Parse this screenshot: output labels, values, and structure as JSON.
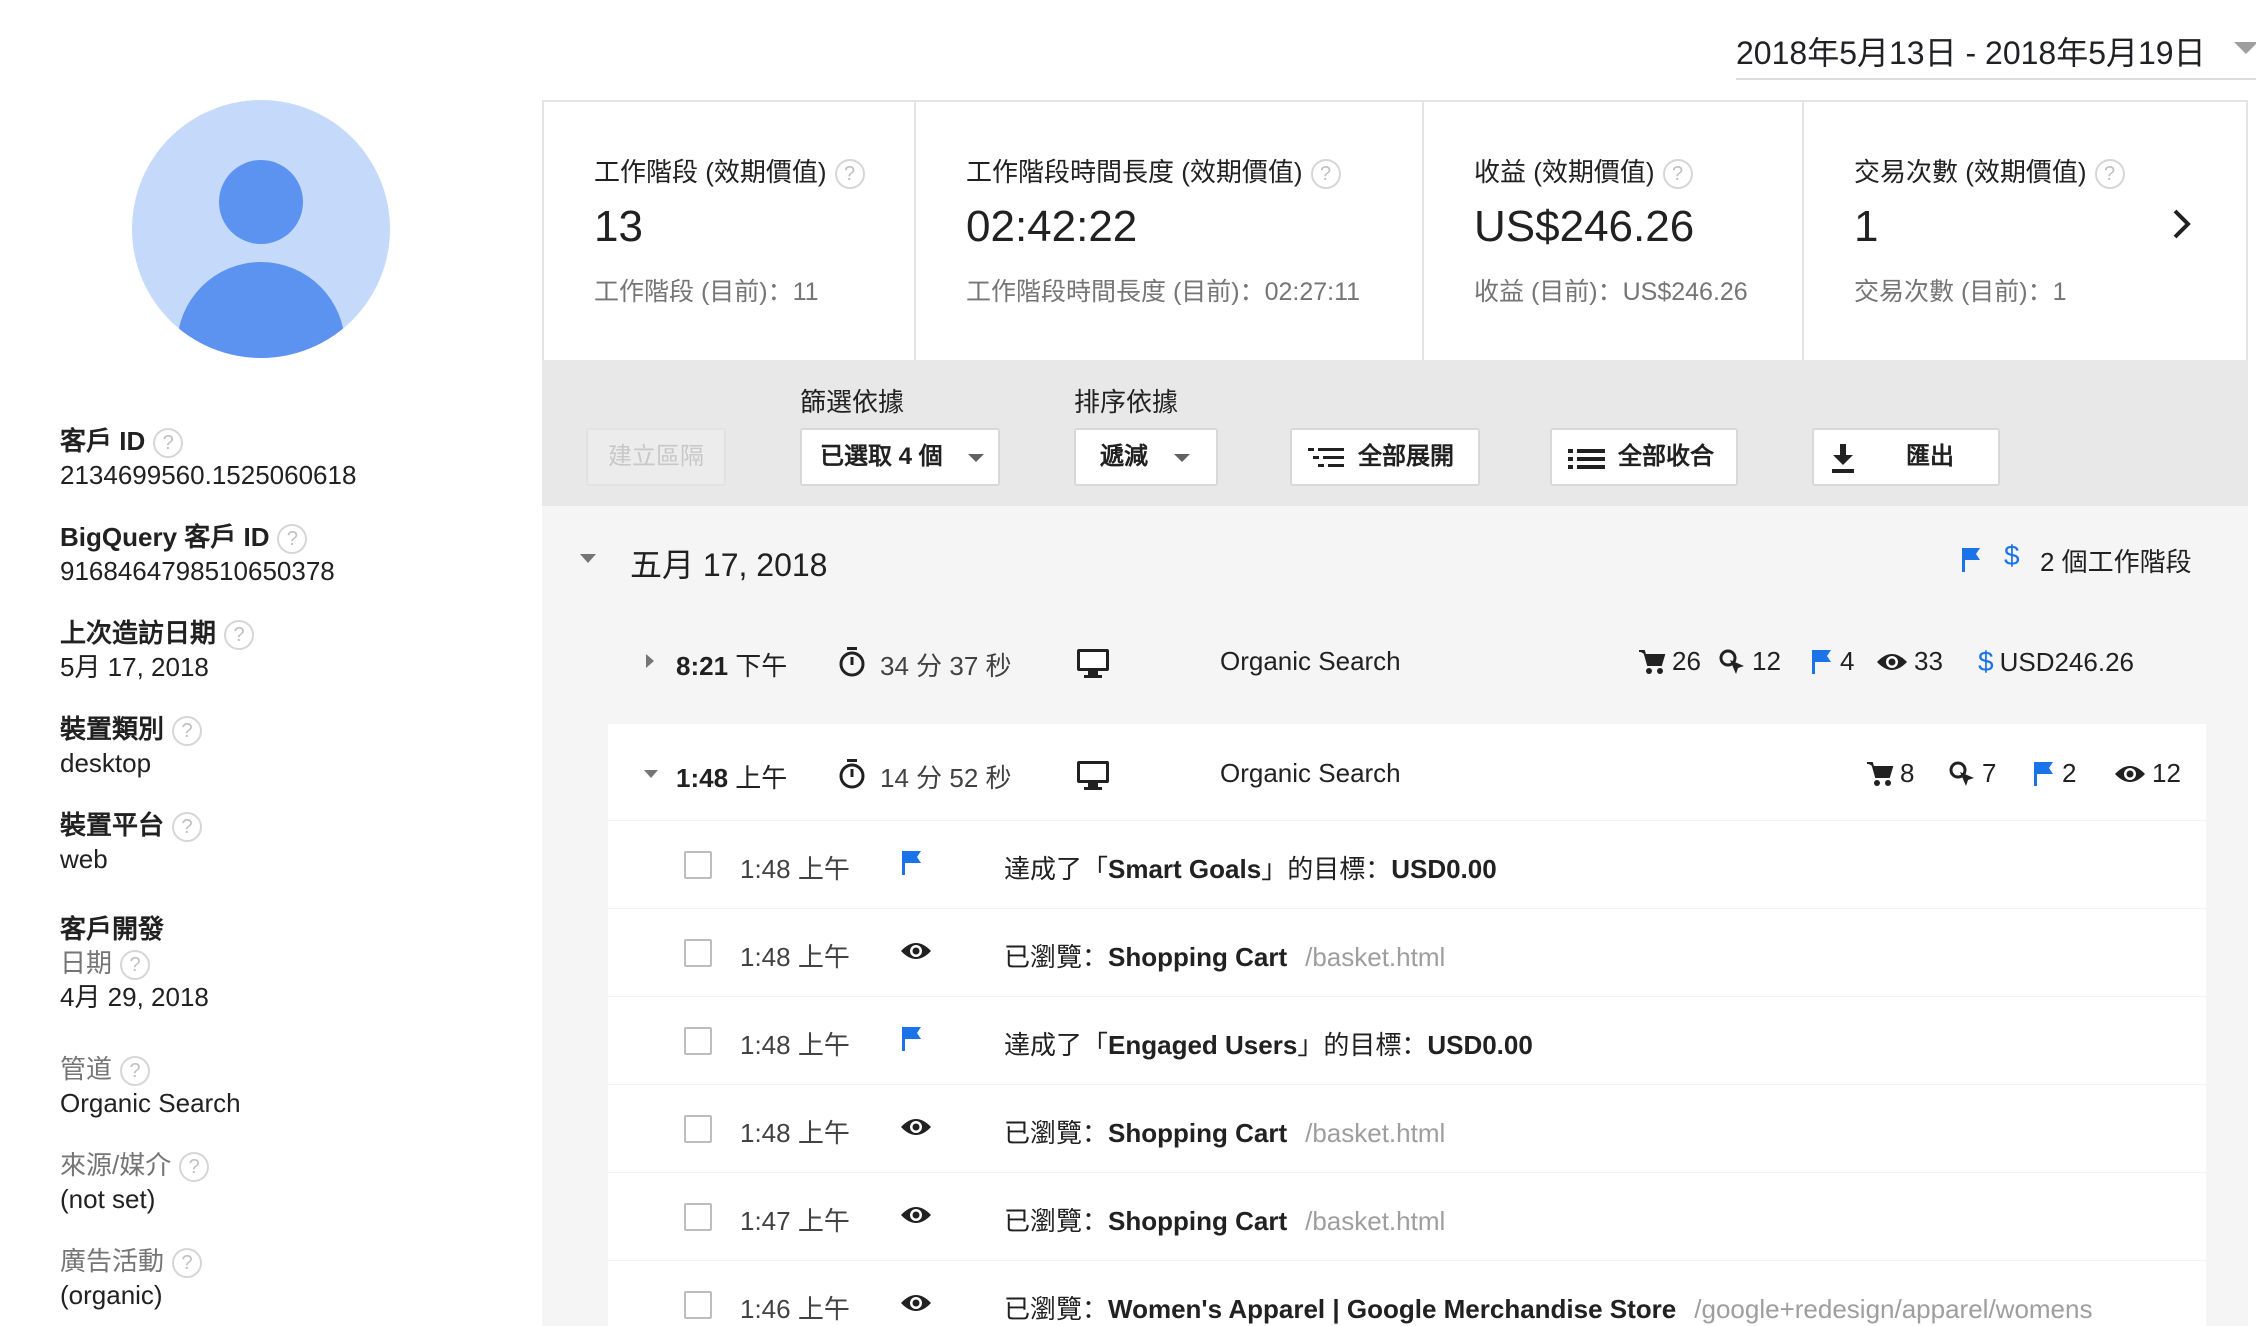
{
  "date_range": "2018年5月13日 - 2018年5月19日",
  "customer": {
    "items": [
      {
        "label": "客戶 ID",
        "value": "2134699560.1525060618",
        "help": "?"
      },
      {
        "label": "BigQuery 客戶 ID",
        "value": "9168464798510650378",
        "help": "?"
      },
      {
        "label": "上次造訪日期",
        "value": "5月 17, 2018",
        "help": "?"
      },
      {
        "label": "裝置類別",
        "value": "desktop",
        "help": "?"
      },
      {
        "label": "裝置平台",
        "value": "web",
        "help": "?"
      },
      {
        "label": "客戶開發",
        "label2": "日期",
        "value": "4月 29, 2018",
        "help": "?"
      },
      {
        "label": "管道",
        "value": "Organic Search",
        "help": "?"
      },
      {
        "label": "來源/媒介",
        "value": "(not set)",
        "help": "?"
      },
      {
        "label": "廣告活動",
        "value": "(organic)",
        "help": "?"
      }
    ]
  },
  "metrics": [
    {
      "label": "工作階段 (效期價值)",
      "value": "13",
      "sub": "工作階段 (目前)：11",
      "help": "?"
    },
    {
      "label": "工作階段時間長度 (效期價值)",
      "value": "02:42:22",
      "sub": "工作階段時間長度 (目前)：02:27:11",
      "help": "?"
    },
    {
      "label": "收益 (效期價值)",
      "value": "US$246.26",
      "sub": "收益 (目前)：US$246.26",
      "help": "?"
    },
    {
      "label": "交易次數 (效期價值)",
      "value": "1",
      "sub": "交易次數 (目前)：1",
      "help": "?"
    }
  ],
  "toolbar": {
    "create_segment": "建立區隔",
    "filter_title": "篩選依據",
    "filter_value": "已選取 4 個",
    "sort_title": "排序依據",
    "sort_value": "遞減",
    "expand_all": "全部展開",
    "collapse_all": "全部收合",
    "export": "匯出"
  },
  "day": {
    "date": "五月 17, 2018",
    "summary": "2 個工作階段"
  },
  "sessions": [
    {
      "time_bold": "8:21",
      "time_suffix": "下午",
      "duration": "34 分 37 秒",
      "channel": "Organic Search",
      "stats": {
        "cart": "26",
        "click": "12",
        "goal": "4",
        "view": "33",
        "revenue": "USD246.26"
      }
    },
    {
      "time_bold": "1:48",
      "time_suffix": "上午",
      "duration": "14 分 52 秒",
      "channel": "Organic Search",
      "stats": {
        "cart": "8",
        "click": "7",
        "goal": "2",
        "view": "12"
      }
    }
  ],
  "hits": [
    {
      "time": "1:48 上午",
      "icon": "flag-icon",
      "prefix": "達成了「",
      "bold": "Smart Goals",
      "suffix": "」的目標：",
      "bold2": "USD0.00",
      "path": ""
    },
    {
      "time": "1:48 上午",
      "icon": "eye-icon",
      "prefix": "已瀏覽：",
      "bold": "Shopping Cart",
      "suffix": "",
      "bold2": "",
      "path": "/basket.html"
    },
    {
      "time": "1:48 上午",
      "icon": "flag-icon",
      "prefix": "達成了「",
      "bold": "Engaged Users",
      "suffix": "」的目標：",
      "bold2": "USD0.00",
      "path": ""
    },
    {
      "time": "1:48 上午",
      "icon": "eye-icon",
      "prefix": "已瀏覽：",
      "bold": "Shopping Cart",
      "suffix": "",
      "bold2": "",
      "path": "/basket.html"
    },
    {
      "time": "1:47 上午",
      "icon": "eye-icon",
      "prefix": "已瀏覽：",
      "bold": "Shopping Cart",
      "suffix": "",
      "bold2": "",
      "path": "/basket.html"
    },
    {
      "time": "1:46 上午",
      "icon": "eye-icon",
      "prefix": "已瀏覽：",
      "bold": "Women's Apparel | Google Merchandise Store",
      "suffix": "",
      "bold2": "",
      "path": "/google+redesign/apparel/womens"
    }
  ],
  "colors": {
    "accent_blue": "#1a73e8",
    "avatar_bg": "#c5d9fb",
    "avatar_fg": "#5c92f0",
    "toolbar_bg": "#e8e8e8"
  }
}
